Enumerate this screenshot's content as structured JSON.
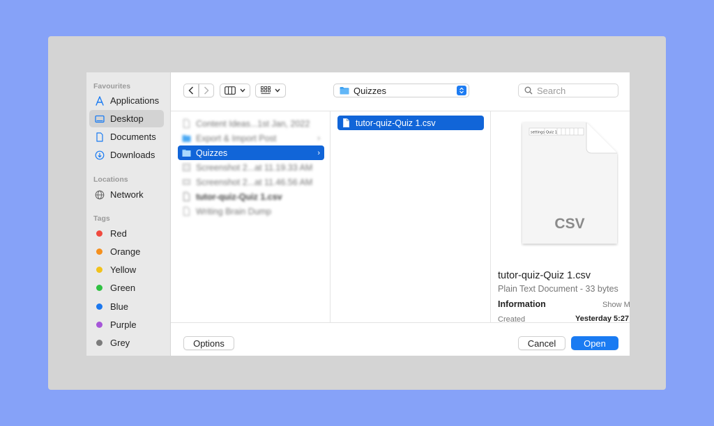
{
  "sidebar": {
    "favourites_header": "Favourites",
    "favourites": [
      {
        "label": "Applications",
        "icon": "applications-icon"
      },
      {
        "label": "Desktop",
        "icon": "desktop-icon",
        "selected": true
      },
      {
        "label": "Documents",
        "icon": "document-icon"
      },
      {
        "label": "Downloads",
        "icon": "downloads-icon"
      }
    ],
    "locations_header": "Locations",
    "locations": [
      {
        "label": "Network",
        "icon": "network-icon"
      }
    ],
    "tags_header": "Tags",
    "tags": [
      {
        "label": "Red",
        "color": "#f04a3f"
      },
      {
        "label": "Orange",
        "color": "#f5901e"
      },
      {
        "label": "Yellow",
        "color": "#f2c21b"
      },
      {
        "label": "Green",
        "color": "#30c142"
      },
      {
        "label": "Blue",
        "color": "#1c78ee"
      },
      {
        "label": "Purple",
        "color": "#a656d8"
      },
      {
        "label": "Grey",
        "color": "#7c7c7c"
      }
    ]
  },
  "toolbar": {
    "path_label": "Quizzes",
    "search_placeholder": "Search"
  },
  "column1": {
    "items": [
      {
        "label": "Content Ideas...1st Jan, 2022",
        "icon": "file-icon",
        "blurred": true
      },
      {
        "label": "Export & Import Post",
        "icon": "folder-icon",
        "blurred": true,
        "chevron": true
      },
      {
        "label": "Quizzes",
        "icon": "folder-icon",
        "selected": true,
        "chevron": true
      },
      {
        "label": "Screenshot 2...at 11.19.33 AM",
        "icon": "image-file-icon",
        "blurred": true
      },
      {
        "label": "Screenshot 2...at 11.46.56 AM",
        "icon": "image-file-icon",
        "blurred": true
      },
      {
        "label": "tutor-quiz-Quiz 1.csv",
        "icon": "file-icon",
        "blurred": true
      },
      {
        "label": "Writing Brain Dump",
        "icon": "file-icon",
        "blurred": true
      }
    ]
  },
  "column2": {
    "items": [
      {
        "label": "tutor-quiz-Quiz 1.csv",
        "icon": "file-icon",
        "selected": true
      }
    ]
  },
  "preview": {
    "thumb_cells": [
      "settings",
      "Quiz 1"
    ],
    "extension": "CSV",
    "name": "tutor-quiz-Quiz 1.csv",
    "kind": "Plain Text Document - 33 bytes",
    "info_header": "Information",
    "show_more": "Show M",
    "created_label": "Created",
    "created_value": "Yesterday 5:27"
  },
  "footer": {
    "options_label": "Options",
    "cancel_label": "Cancel",
    "open_label": "Open"
  },
  "colors": {
    "accent": "#1a7bf2",
    "selection": "#1165d8",
    "background": "#86a2f8"
  }
}
